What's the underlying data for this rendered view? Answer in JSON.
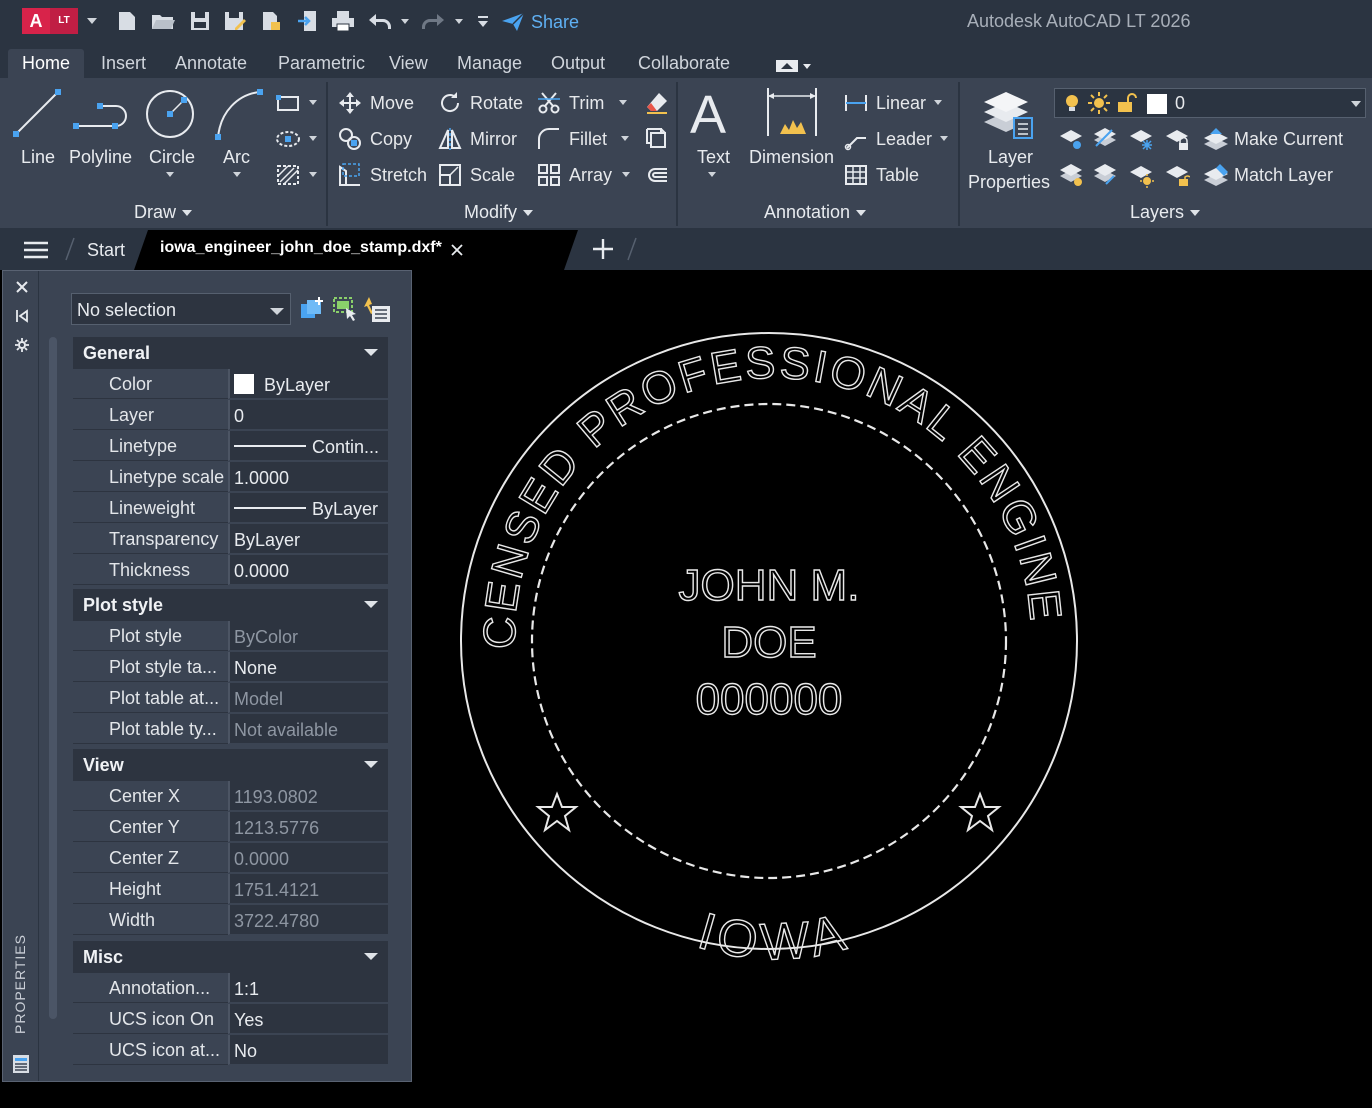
{
  "app": {
    "title": "Autodesk AutoCAD LT 2026",
    "badge_letter": "A",
    "badge_sub": "LT"
  },
  "quick_access": {
    "share_label": "Share"
  },
  "ribbon_tabs": [
    "Home",
    "Insert",
    "Annotate",
    "Parametric",
    "View",
    "Manage",
    "Output",
    "Collaborate"
  ],
  "ribbon": {
    "draw": {
      "title": "Draw",
      "line": "Line",
      "polyline": "Polyline",
      "circle": "Circle",
      "arc": "Arc"
    },
    "modify": {
      "title": "Modify",
      "move": "Move",
      "rotate": "Rotate",
      "trim": "Trim",
      "copy": "Copy",
      "mirror": "Mirror",
      "fillet": "Fillet",
      "stretch": "Stretch",
      "scale": "Scale",
      "array": "Array"
    },
    "annotation": {
      "title": "Annotation",
      "text": "Text",
      "dimension": "Dimension",
      "linear": "Linear",
      "leader": "Leader",
      "table": "Table"
    },
    "layers": {
      "title": "Layers",
      "layer_properties_1": "Layer",
      "layer_properties_2": "Properties",
      "current_layer": "0",
      "make_current": "Make Current",
      "match_layer": "Match Layer"
    }
  },
  "doc_tabs": {
    "start": "Start",
    "active": "iowa_engineer_john_doe_stamp.dxf*"
  },
  "properties": {
    "palette_label": "PROPERTIES",
    "selection": "No selection",
    "sections": [
      {
        "title": "General",
        "rows": [
          {
            "key": "Color",
            "value": "ByLayer",
            "readonly": false
          },
          {
            "key": "Layer",
            "value": "0",
            "readonly": false
          },
          {
            "key": "Linetype",
            "value": "Contin...",
            "readonly": false
          },
          {
            "key": "Linetype scale",
            "value": "1.0000",
            "readonly": false
          },
          {
            "key": "Lineweight",
            "value": "ByLayer",
            "readonly": false
          },
          {
            "key": "Transparency",
            "value": "ByLayer",
            "readonly": false
          },
          {
            "key": "Thickness",
            "value": "0.0000",
            "readonly": false
          }
        ]
      },
      {
        "title": "Plot style",
        "rows": [
          {
            "key": "Plot style",
            "value": "ByColor",
            "readonly": true
          },
          {
            "key": "Plot style ta...",
            "value": "None",
            "readonly": false
          },
          {
            "key": "Plot table at...",
            "value": "Model",
            "readonly": true
          },
          {
            "key": "Plot table ty...",
            "value": "Not available",
            "readonly": true
          }
        ]
      },
      {
        "title": "View",
        "rows": [
          {
            "key": "Center X",
            "value": "1193.0802",
            "readonly": true
          },
          {
            "key": "Center Y",
            "value": "1213.5776",
            "readonly": true
          },
          {
            "key": "Center Z",
            "value": "0.0000",
            "readonly": true
          },
          {
            "key": "Height",
            "value": "1751.4121",
            "readonly": true
          },
          {
            "key": "Width",
            "value": "3722.4780",
            "readonly": true
          }
        ]
      },
      {
        "title": "Misc",
        "rows": [
          {
            "key": "Annotation...",
            "value": "1:1",
            "readonly": false
          },
          {
            "key": "UCS icon On",
            "value": "Yes",
            "readonly": false
          },
          {
            "key": "UCS icon at...",
            "value": "No",
            "readonly": false
          }
        ]
      }
    ]
  },
  "stamp": {
    "top_arc": "LICENSED PROFESSIONAL ENGINEER",
    "bottom_arc": "IOWA",
    "line1": "JOHN M.",
    "line2": "DOE",
    "line3": "000000"
  }
}
